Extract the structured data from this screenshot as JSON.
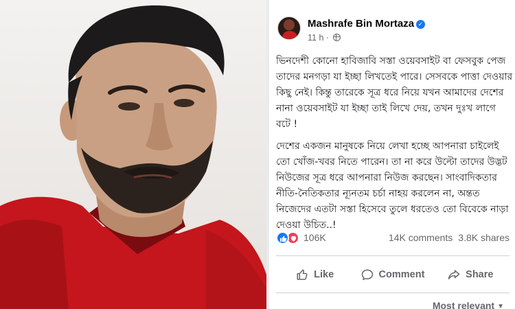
{
  "post": {
    "author": "Mashrafe Bin Mortaza",
    "time": "11 h",
    "separator": "·",
    "paragraphs": [
      "ভিনদেশী কোনো হাবিজাবি সস্তা ওয়েবসাইট বা ফেসবুক পেজ তাদের মনগড়া যা ইচ্ছা লিখতেই পারে। সেসবকে পাত্তা দেওয়ার কিছু নেই। কিন্তু তারেকে সূত্র ধরে নিয়ে যখন আমাদের দেশের নানা ওয়েবসাইট যা ইচ্ছা তাই লিখে দেয়, তখন দুঃখ লাগে বটে !",
      "দেশের একজন মানুষকে নিয়ে লেখা হচ্ছে আপনারা চাইলেই তো খোঁজ-খবর নিতে পারেন। তা না করে উল্টো তাদের উদ্ভট নিউজের সূত্র ধরে আপনারা নিউজ করছেন। সাংবাদিকতার নীতি-নৈতিকতার ন্যূনতম চর্চা নাহয় করলেন না, অন্তত নিজেদের এতটা সস্তা হিসেবে তুলে ধরতেও তো বিবেকে নাড়া দেওয়া উচিত..!"
    ],
    "reactions_count": "106K",
    "comments": "14K comments",
    "shares": "3.8K shares",
    "actions": {
      "like": "Like",
      "comment": "Comment",
      "share": "Share"
    },
    "sort_label": "Most relevant"
  },
  "colors": {
    "facebook_blue": "#1877f2",
    "love_red": "#f33e58",
    "muted_text": "#65676b"
  },
  "icons": [
    "verified-badge-icon",
    "globe-icon",
    "like-reaction-icon",
    "love-reaction-icon",
    "like-icon",
    "comment-icon",
    "share-icon",
    "chevron-down-icon"
  ]
}
